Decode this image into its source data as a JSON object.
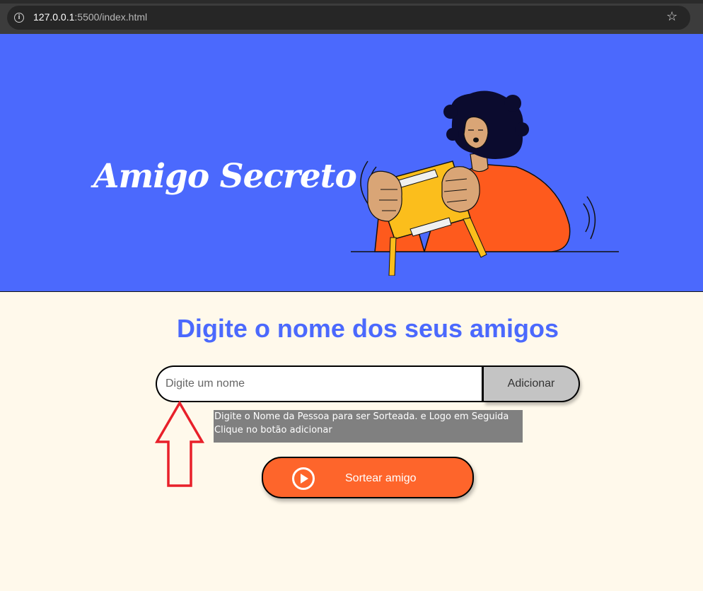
{
  "browser": {
    "url_host": "127.0.0.1",
    "url_rest": ":5500/index.html",
    "info_icon": "i",
    "star_icon": "☆"
  },
  "banner": {
    "title": "Amigo Secreto",
    "background": "#4b69fd"
  },
  "main": {
    "heading": "Digite o nome dos seus amigos",
    "input_placeholder": "Digite um nome",
    "input_value": "",
    "add_button_label": "Adicionar",
    "tooltip_line1": "Digite o Nome da Pessoa para ser Sorteada. e Logo em Seguida",
    "tooltip_line2": "Clique no botão adicionar",
    "draw_button_label": "Sortear amigo"
  },
  "colors": {
    "accent": "#4b69fd",
    "button_orange": "#fe652b",
    "page_bg": "#fff9eb",
    "annotation_arrow": "#e8202a"
  },
  "icons": [
    "info-icon",
    "star-icon",
    "play-circle-icon",
    "up-arrow-annotation"
  ]
}
